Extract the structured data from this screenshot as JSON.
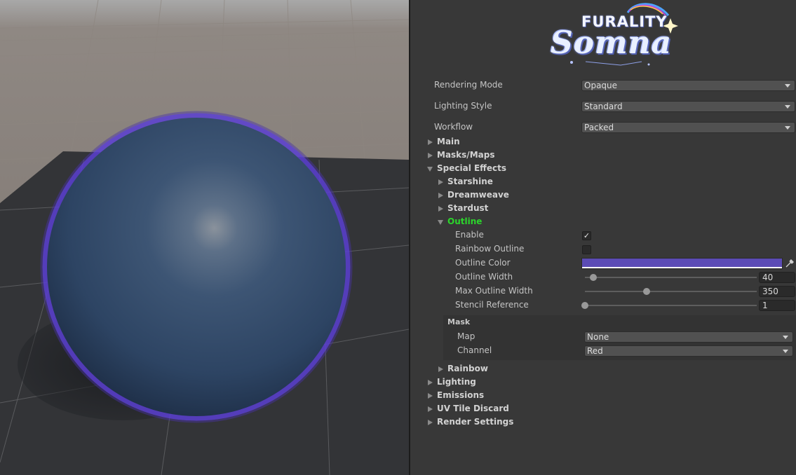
{
  "logo": {
    "line1": "FURALITY",
    "line2": "Somna"
  },
  "properties": {
    "rendering_mode": {
      "label": "Rendering Mode",
      "value": "Opaque"
    },
    "lighting_style": {
      "label": "Lighting Style",
      "value": "Standard"
    },
    "workflow": {
      "label": "Workflow",
      "value": "Packed"
    }
  },
  "sections": {
    "main": "Main",
    "masks_maps": "Masks/Maps",
    "special_effects": "Special Effects",
    "lighting": "Lighting",
    "emissions": "Emissions",
    "uv_tile_discard": "UV Tile Discard",
    "render_settings": "Render Settings"
  },
  "effects": {
    "starshine": "Starshine",
    "dreamweave": "Dreamweave",
    "stardust": "Stardust",
    "outline": "Outline",
    "rainbow": "Rainbow"
  },
  "outline": {
    "enable": {
      "label": "Enable",
      "checked": true,
      "mark": "✓"
    },
    "rainbow_outline": {
      "label": "Rainbow Outline",
      "checked": false
    },
    "outline_color": {
      "label": "Outline Color",
      "color": "#5b4bb5"
    },
    "outline_width": {
      "label": "Outline Width",
      "value": "40",
      "fraction": 0.05
    },
    "max_outline_width": {
      "label": "Max Outline Width",
      "value": "350",
      "fraction": 0.36
    },
    "stencil_reference": {
      "label": "Stencil Reference",
      "value": "1",
      "fraction": 0.0
    }
  },
  "mask": {
    "title": "Mask",
    "map": {
      "label": "Map",
      "value": "None"
    },
    "channel": {
      "label": "Channel",
      "value": "Red"
    }
  },
  "colors": {
    "active_section": "#2bd52b",
    "outline_glow": "#5b3fd1",
    "sphere": "#2f4868"
  }
}
